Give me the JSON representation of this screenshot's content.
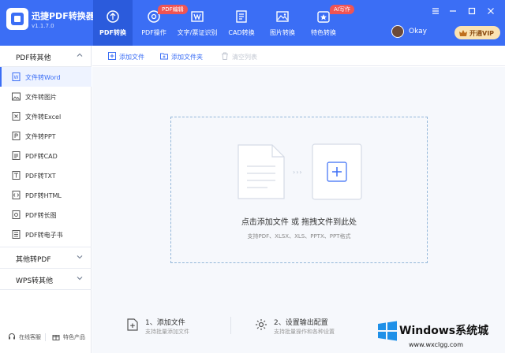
{
  "app": {
    "title": "迅捷PDF转换器",
    "version": "v1.1.7.0"
  },
  "nav": {
    "tabs": [
      {
        "label": "PDF转换",
        "icon": "convert-icon",
        "active": true
      },
      {
        "label": "PDF操作",
        "icon": "disc-icon"
      },
      {
        "label": "文字/票证识别",
        "icon": "scan-icon"
      },
      {
        "label": "CAD转换",
        "icon": "cad-icon"
      },
      {
        "label": "图片转换",
        "icon": "image-icon"
      },
      {
        "label": "特色转换",
        "icon": "star-icon"
      }
    ],
    "badges": {
      "pdf_edit": "PDF编辑",
      "ai_write": "AI写作"
    }
  },
  "user": {
    "name": "Okay"
  },
  "vip_button": {
    "label": "开通VIP"
  },
  "sidebar": {
    "group_pdf": "PDF转其他",
    "items": [
      {
        "label": "文件转Word",
        "icon": "word-icon",
        "active": true
      },
      {
        "label": "文件转图片",
        "icon": "picture-icon"
      },
      {
        "label": "文件转Excel",
        "icon": "excel-icon"
      },
      {
        "label": "文件转PPT",
        "icon": "ppt-icon"
      },
      {
        "label": "PDF转CAD",
        "icon": "cad-file-icon"
      },
      {
        "label": "PDF转TXT",
        "icon": "txt-icon"
      },
      {
        "label": "PDF转HTML",
        "icon": "html-icon"
      },
      {
        "label": "PDF转长图",
        "icon": "long-image-icon"
      },
      {
        "label": "PDF转电子书",
        "icon": "ebook-icon"
      }
    ],
    "group_other": "其他转PDF",
    "group_wps": "WPS转其他",
    "footer": {
      "service": "在线客服",
      "products": "特色产品"
    }
  },
  "toolbar": {
    "add_file": "添加文件",
    "add_folder": "添加文件夹",
    "clear_list": "清空列表"
  },
  "dropzone": {
    "main": "点击添加文件 或 拖拽文件到此处",
    "sub": "支持PDF、XLSX、XLS、PPTX、PPT格式",
    "arrows": "›››"
  },
  "steps": [
    {
      "title": "1、添加文件",
      "desc": "支持批量添加文件"
    },
    {
      "title": "2、设置输出配置",
      "desc": "支持批量操作和各种设置"
    }
  ],
  "watermark": {
    "title": "Windows系统城",
    "url": "www.wxclgg.com"
  },
  "colors": {
    "primary": "#3b6ef5",
    "vip_bg": "#fbe3b2",
    "badge": "#f05454"
  }
}
